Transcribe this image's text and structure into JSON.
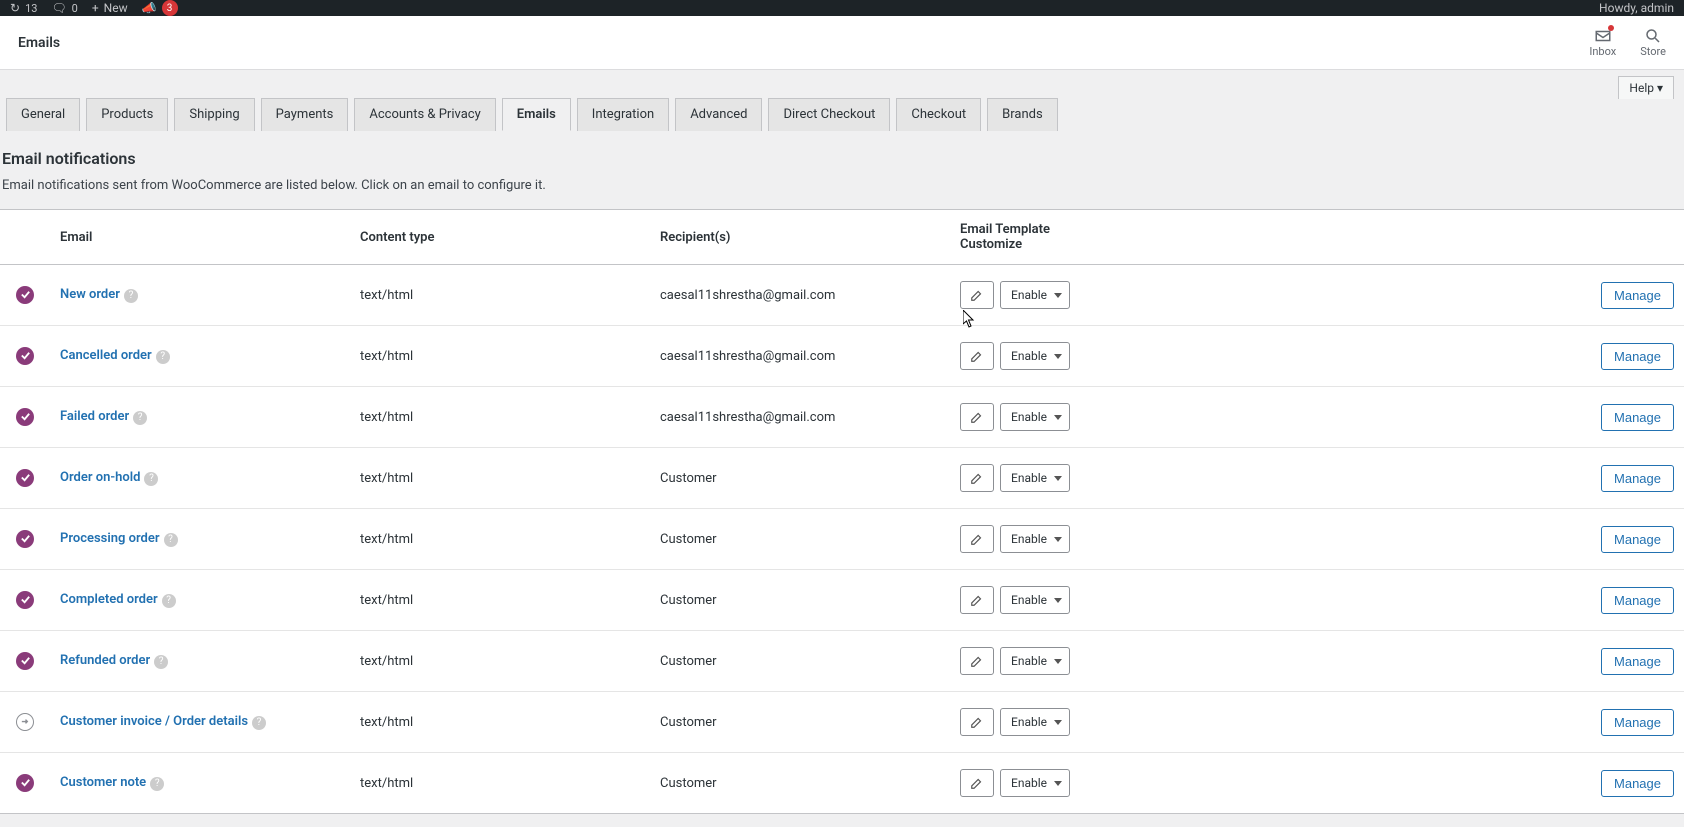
{
  "adminBar": {
    "updates": "13",
    "comments": "0",
    "new": "New",
    "notification": "3",
    "howdy": "Howdy, admin"
  },
  "titleBar": {
    "title": "Emails",
    "inbox": "Inbox",
    "store": "Store"
  },
  "helpTab": "Help ▾",
  "tabs": [
    {
      "label": "General",
      "active": false
    },
    {
      "label": "Products",
      "active": false
    },
    {
      "label": "Shipping",
      "active": false
    },
    {
      "label": "Payments",
      "active": false
    },
    {
      "label": "Accounts & Privacy",
      "active": false
    },
    {
      "label": "Emails",
      "active": true
    },
    {
      "label": "Integration",
      "active": false
    },
    {
      "label": "Advanced",
      "active": false
    },
    {
      "label": "Direct Checkout",
      "active": false
    },
    {
      "label": "Checkout",
      "active": false
    },
    {
      "label": "Brands",
      "active": false
    }
  ],
  "section": {
    "heading": "Email notifications",
    "desc": "Email notifications sent from WooCommerce are listed below. Click on an email to configure it."
  },
  "columns": {
    "status": "",
    "email": "Email",
    "content": "Content type",
    "recipient": "Recipient(s)",
    "customize": "Email Template Customize",
    "manage": ""
  },
  "enableLabel": "Enable",
  "manageLabel": "Manage",
  "rows": [
    {
      "status": "enabled",
      "name": "New order",
      "content": "text/html",
      "recipient": "caesal11shrestha@gmail.com"
    },
    {
      "status": "enabled",
      "name": "Cancelled order",
      "content": "text/html",
      "recipient": "caesal11shrestha@gmail.com"
    },
    {
      "status": "enabled",
      "name": "Failed order",
      "content": "text/html",
      "recipient": "caesal11shrestha@gmail.com"
    },
    {
      "status": "enabled",
      "name": "Order on-hold",
      "content": "text/html",
      "recipient": "Customer"
    },
    {
      "status": "enabled",
      "name": "Processing order",
      "content": "text/html",
      "recipient": "Customer"
    },
    {
      "status": "enabled",
      "name": "Completed order",
      "content": "text/html",
      "recipient": "Customer"
    },
    {
      "status": "enabled",
      "name": "Refunded order",
      "content": "text/html",
      "recipient": "Customer"
    },
    {
      "status": "manual",
      "name": "Customer invoice / Order details",
      "content": "text/html",
      "recipient": "Customer"
    },
    {
      "status": "enabled",
      "name": "Customer note",
      "content": "text/html",
      "recipient": "Customer"
    }
  ]
}
